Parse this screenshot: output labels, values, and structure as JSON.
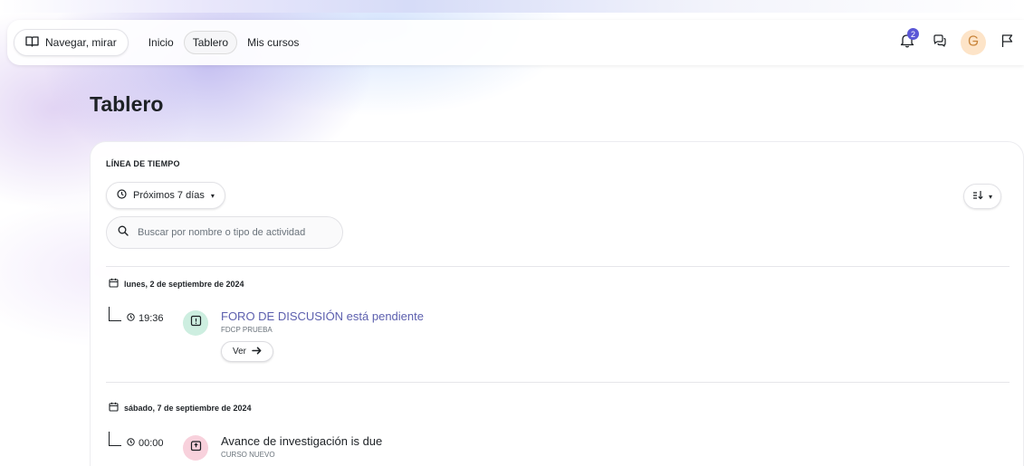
{
  "nav": {
    "browse_label": "Navegar, mirar",
    "links": [
      {
        "label": "Inicio",
        "active": false
      },
      {
        "label": "Tablero",
        "active": true
      },
      {
        "label": "Mis cursos",
        "active": false
      }
    ],
    "notification_count": "2",
    "icons": [
      "book-open-icon",
      "bell-icon",
      "chat-icon",
      "user-avatar-icon",
      "flag-icon"
    ]
  },
  "page": {
    "title": "Tablero"
  },
  "timeline": {
    "section_label": "LÍNEA DE TIEMPO",
    "range_label": "Próximos 7 días",
    "search_placeholder": "Buscar por nombre o tipo de actividad",
    "sort_icon": "sort-icon",
    "groups": [
      {
        "date": "lunes, 2 de septiembre de 2024",
        "events": [
          {
            "time": "19:36",
            "title": "FORO DE DISCUSIÓN está pendiente",
            "course": "FDCP PRUEBA",
            "action_label": "Ver",
            "icon": "forum-icon",
            "icon_color": "#cdeee0"
          }
        ]
      },
      {
        "date": "sábado, 7 de septiembre de 2024",
        "events": [
          {
            "time": "00:00",
            "title": "Avance de investigación is due",
            "course": "CURSO NUEVO",
            "icon": "assignment-icon",
            "icon_color": "#f8d1dc"
          }
        ]
      }
    ]
  },
  "colors": {
    "accent": "#5b57d6",
    "link": "#5c5fae"
  }
}
